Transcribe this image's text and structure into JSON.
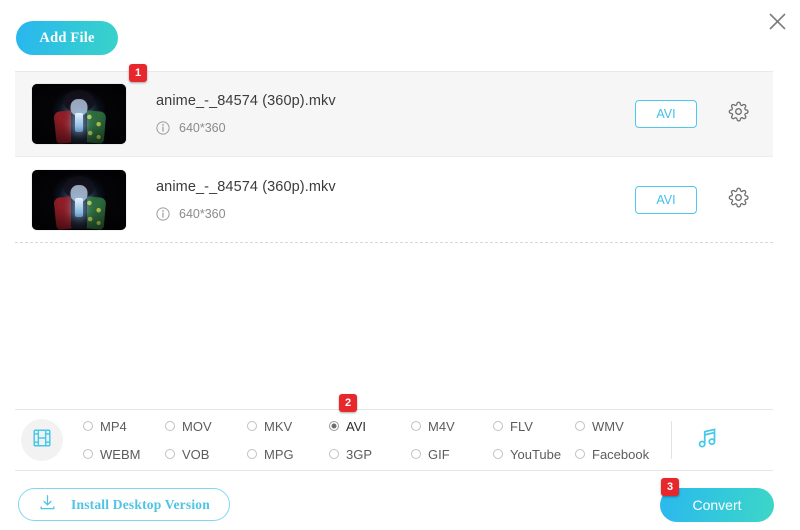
{
  "window": {
    "close_icon": "close-icon"
  },
  "toolbar": {
    "add_file_label": "Add File"
  },
  "badges": {
    "one": "1",
    "two": "2",
    "three": "3"
  },
  "files": [
    {
      "name": "anime_-_84574 (360p).mkv",
      "resolution": "640*360",
      "format_label": "AVI",
      "info_icon": "info-icon",
      "settings_icon": "gear-icon",
      "selected": true
    },
    {
      "name": "anime_-_84574 (360p).mkv",
      "resolution": "640*360",
      "format_label": "AVI",
      "info_icon": "info-icon",
      "settings_icon": "gear-icon",
      "selected": false
    }
  ],
  "formats": {
    "category_icon": "film-strip-icon",
    "audio_icon": "music-note-icon",
    "options": [
      {
        "label": "MP4",
        "selected": false
      },
      {
        "label": "MOV",
        "selected": false
      },
      {
        "label": "MKV",
        "selected": false
      },
      {
        "label": "AVI",
        "selected": true
      },
      {
        "label": "M4V",
        "selected": false
      },
      {
        "label": "FLV",
        "selected": false
      },
      {
        "label": "WMV",
        "selected": false
      },
      {
        "label": "WEBM",
        "selected": false
      },
      {
        "label": "VOB",
        "selected": false
      },
      {
        "label": "MPG",
        "selected": false
      },
      {
        "label": "3GP",
        "selected": false
      },
      {
        "label": "GIF",
        "selected": false
      },
      {
        "label": "YouTube",
        "selected": false
      },
      {
        "label": "Facebook",
        "selected": false
      }
    ],
    "selected_value": "AVI"
  },
  "footer": {
    "install_label": "Install Desktop Version",
    "install_icon": "download-icon",
    "convert_label": "Convert"
  },
  "colors": {
    "accent": "#3ac8e8",
    "accent_end": "#3dd6c6",
    "badge": "#e8272c",
    "row_selected_bg": "#f6f6f6"
  }
}
